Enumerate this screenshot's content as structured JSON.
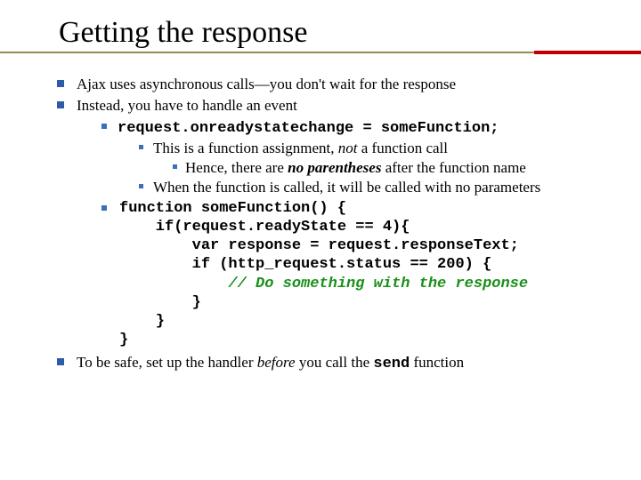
{
  "title": "Getting the response",
  "b1": "Ajax uses asynchronous calls—you don't wait for the response",
  "b2": "Instead, you have to handle an event",
  "code1": "request.onreadystatechange = someFunction;",
  "note1_a": "This is a function assignment, ",
  "note1_not": "not",
  "note1_b": " a function call",
  "note1_sub_a": "Hence, there are ",
  "note1_sub_bold": "no parentheses",
  "note1_sub_b": " after the function name",
  "note2": "When the function is called, it will be called with no parameters",
  "fn_l1": "function someFunction() {",
  "fn_l2": "    if(request.readyState == 4){",
  "fn_l3": "        var response = request.responseText;",
  "fn_l4": "        if (http_request.status == 200) {",
  "fn_comment": "            // Do something with the response",
  "fn_l5": "        }",
  "fn_l6": "    }",
  "fn_l7": "}",
  "b3_a": "To be safe, set up the handler ",
  "b3_before": "before",
  "b3_b": " you call the ",
  "b3_send": "send",
  "b3_c": " function"
}
